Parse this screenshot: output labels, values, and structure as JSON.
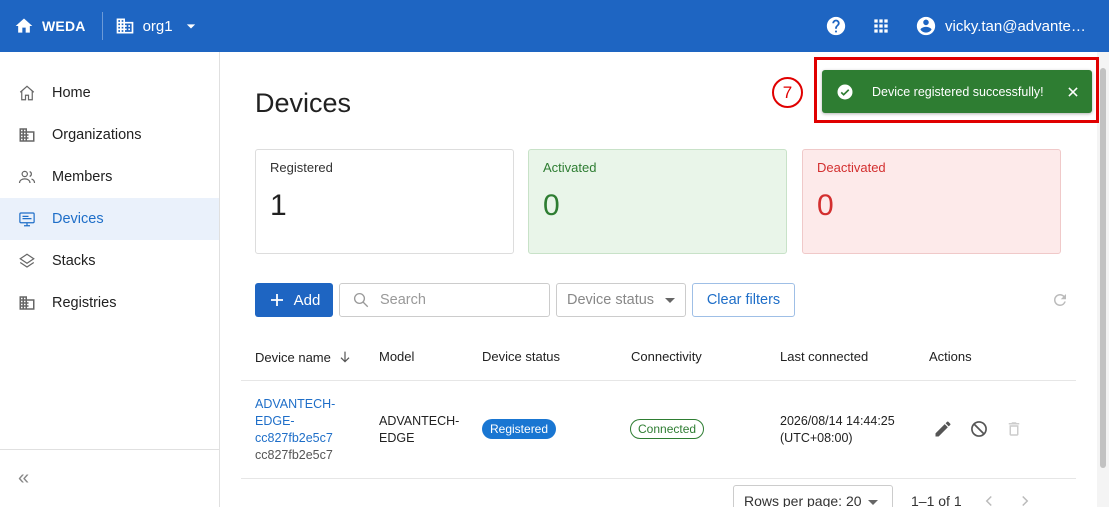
{
  "header": {
    "brand": "WEDA",
    "org": "org1",
    "user_email": "vicky.tan@advantech.com"
  },
  "sidebar": {
    "items": [
      {
        "label": "Home",
        "icon": "home-icon"
      },
      {
        "label": "Organizations",
        "icon": "building-icon"
      },
      {
        "label": "Members",
        "icon": "people-icon"
      },
      {
        "label": "Devices",
        "icon": "monitor-icon",
        "active": true
      },
      {
        "label": "Stacks",
        "icon": "layers-icon"
      },
      {
        "label": "Registries",
        "icon": "building-icon"
      }
    ],
    "collapse_label": "«"
  },
  "page": {
    "title": "Devices"
  },
  "summary": {
    "registered": {
      "label": "Registered",
      "value": "1"
    },
    "activated": {
      "label": "Activated",
      "value": "0"
    },
    "deactivated": {
      "label": "Deactivated",
      "value": "0"
    }
  },
  "toolbar": {
    "add_label": "Add",
    "search_placeholder": "Search",
    "status_placeholder": "Device status",
    "clear_label": "Clear filters"
  },
  "table": {
    "columns": [
      "Device name",
      "Model",
      "Device status",
      "Connectivity",
      "Last connected",
      "Actions"
    ],
    "rows": [
      {
        "name_line1": "ADVANTECH-",
        "name_line2": "EDGE-",
        "name_line3": "cc827fb2e5c7",
        "name_sub": "cc827fb2e5c7",
        "model_line1": "ADVANTECH-",
        "model_line2": "EDGE",
        "status": "Registered",
        "connectivity": "Connected",
        "last_line1": "2026/08/14 14:44:25",
        "last_line2": "(UTC+08:00)"
      }
    ]
  },
  "pagination": {
    "rows_label": "Rows per page: 20",
    "range": "1–1 of 1"
  },
  "toast": {
    "message": "Device registered successfully!"
  },
  "annotation": {
    "step": "7"
  },
  "colors": {
    "primary": "#1e65c2",
    "success": "#2e7d32",
    "danger": "#d32f2f",
    "annotation": "#e00000"
  }
}
